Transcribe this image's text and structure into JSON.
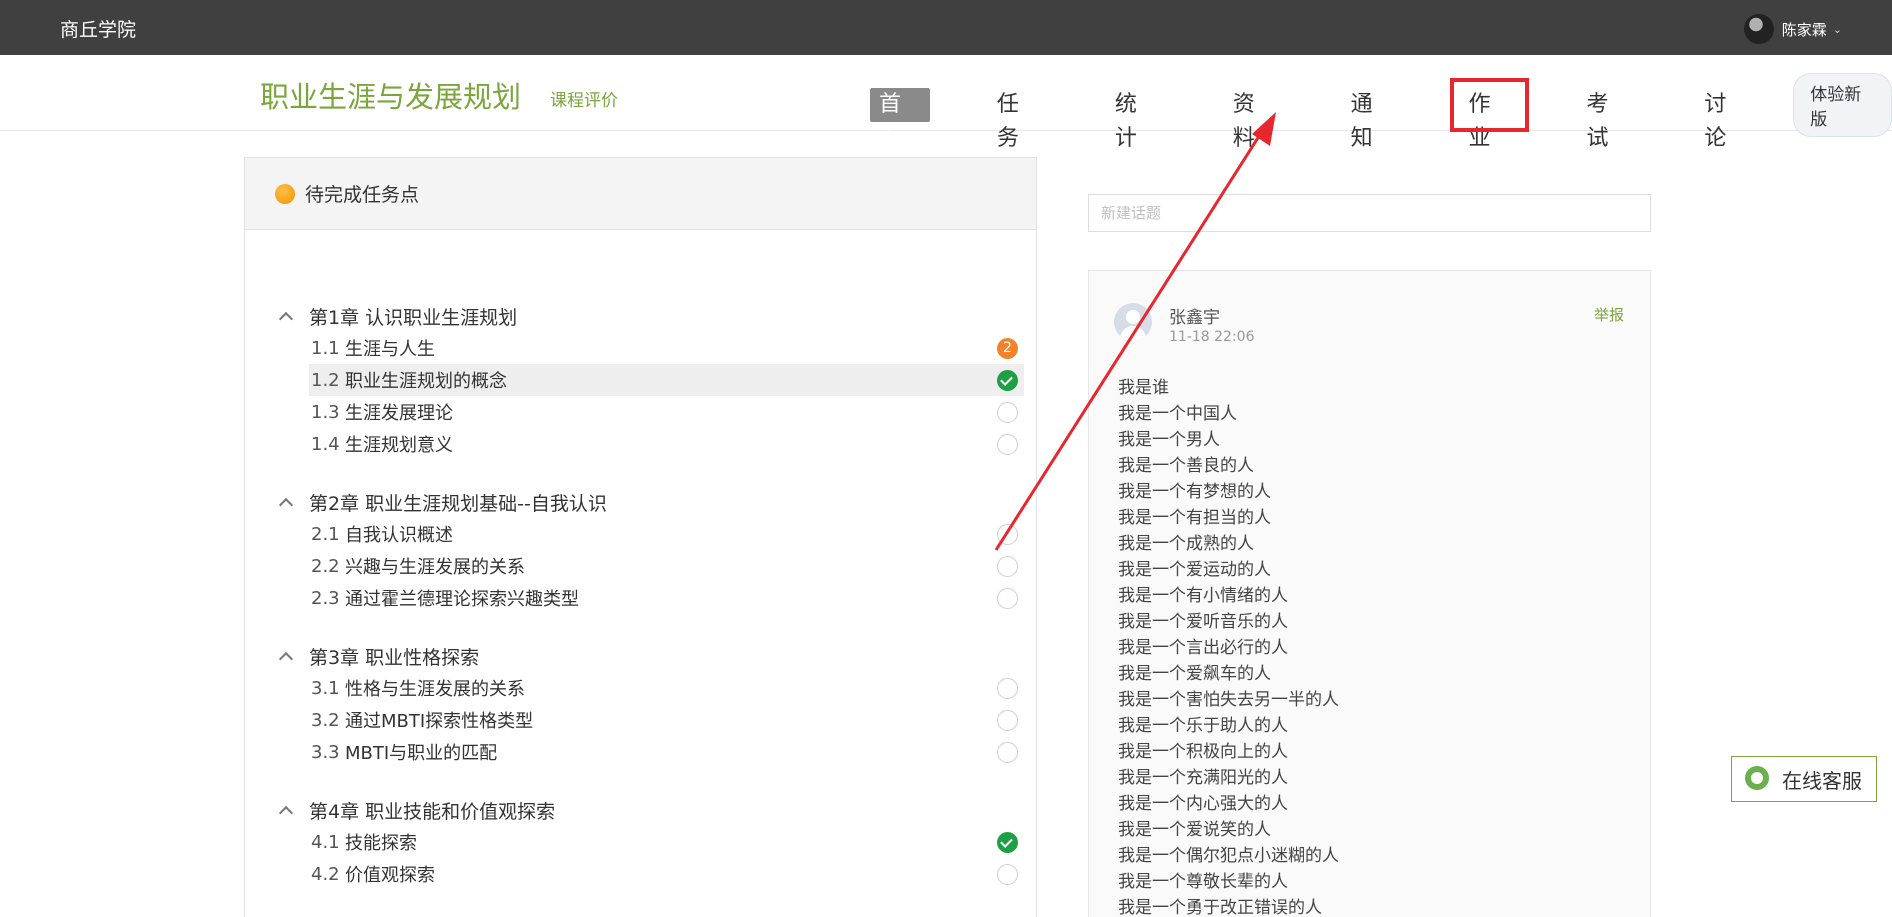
{
  "topbar": {
    "site_name": "商丘学院",
    "user_name": "陈家霖",
    "caret": "⌄"
  },
  "course": {
    "title": "职业生涯与发展规划",
    "eval_link": "课程评价"
  },
  "nav": {
    "items": [
      "首页",
      "任务",
      "统计",
      "资料",
      "通知",
      "作业",
      "考试",
      "讨论"
    ],
    "active": "首页",
    "highlighted": "作业",
    "new_version": "体验新版"
  },
  "tasks_panel": {
    "title": "待完成任务点",
    "chapters": [
      {
        "title": "第1章 认识职业生涯规划",
        "lessons": [
          {
            "num": "1.1",
            "title": "生涯与人生",
            "status": "badge",
            "badge": "2"
          },
          {
            "num": "1.2",
            "title": "职业生涯规划的概念",
            "status": "done",
            "selected": true
          },
          {
            "num": "1.3",
            "title": "生涯发展理论",
            "status": "empty"
          },
          {
            "num": "1.4",
            "title": "生涯规划意义",
            "status": "empty"
          }
        ]
      },
      {
        "title": "第2章 职业生涯规划基础--自我认识",
        "lessons": [
          {
            "num": "2.1",
            "title": "自我认识概述",
            "status": "empty"
          },
          {
            "num": "2.2",
            "title": "兴趣与生涯发展的关系",
            "status": "empty"
          },
          {
            "num": "2.3",
            "title": "通过霍兰德理论探索兴趣类型",
            "status": "empty"
          }
        ]
      },
      {
        "title": "第3章 职业性格探索",
        "lessons": [
          {
            "num": "3.1",
            "title": "性格与生涯发展的关系",
            "status": "empty"
          },
          {
            "num": "3.2",
            "title": "通过MBTI探索性格类型",
            "status": "empty"
          },
          {
            "num": "3.3",
            "title": "MBTI与职业的匹配",
            "status": "empty"
          }
        ]
      },
      {
        "title": "第4章 职业技能和价值观探索",
        "lessons": [
          {
            "num": "4.1",
            "title": "技能探索",
            "status": "done"
          },
          {
            "num": "4.2",
            "title": "价值观探索",
            "status": "empty"
          }
        ]
      }
    ]
  },
  "discussion": {
    "new_topic_placeholder": "新建话题",
    "post": {
      "author": "张鑫宇",
      "time": "11-18 22:06",
      "report": "举报",
      "lines": [
        "我是谁",
        "我是一个中国人",
        "我是一个男人",
        "我是一个善良的人",
        "我是一个有梦想的人",
        "我是一个有担当的人",
        "我是一个成熟的人",
        "我是一个爱运动的人",
        "我是一个有小情绪的人",
        "我是一个爱听音乐的人",
        "我是一个言出必行的人",
        "我是一个爱飙车的人",
        "我是一个害怕失去另一半的人",
        "我是一个乐于助人的人",
        "我是一个积极向上的人",
        "我是一个充满阳光的人",
        "我是一个内心强大的人",
        "我是一个爱说笑的人",
        "我是一个偶尔犯点小迷糊的人",
        "我是一个尊敬长辈的人",
        "我是一个勇于改正错误的人"
      ]
    }
  },
  "service": {
    "label": "在线客服"
  },
  "colors": {
    "topbar": "#404040",
    "brand_green": "#7aa63c",
    "annotation_red": "#e8262d",
    "done_green": "#1ca043",
    "badge_orange": "#f5812a"
  }
}
